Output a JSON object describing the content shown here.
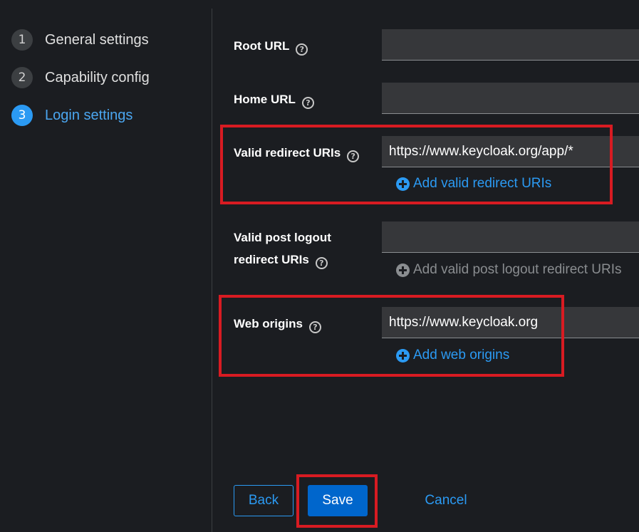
{
  "wizard": {
    "steps": [
      {
        "number": "1",
        "label": "General settings"
      },
      {
        "number": "2",
        "label": "Capability config"
      },
      {
        "number": "3",
        "label": "Login settings",
        "current": true
      }
    ]
  },
  "form": {
    "root_url": {
      "label": "Root URL",
      "value": ""
    },
    "home_url": {
      "label": "Home URL",
      "value": ""
    },
    "valid_redirect_uris": {
      "label": "Valid redirect URIs",
      "value": "https://www.keycloak.org/app/*",
      "add_label": "Add valid redirect URIs"
    },
    "valid_post_logout": {
      "label_line1": "Valid post logout",
      "label_line2": "redirect URIs",
      "value": "",
      "add_label": "Add valid post logout redirect URIs"
    },
    "web_origins": {
      "label": "Web origins",
      "value": "https://www.keycloak.org",
      "add_label": "Add web origins"
    },
    "help_glyph": "?"
  },
  "actions": {
    "back_label": "Back",
    "save_label": "Save",
    "cancel_label": "Cancel"
  },
  "colors": {
    "background": "#1b1d21",
    "accent": "#2b9af3",
    "primary_button": "#0066cc",
    "highlight": "#d81b22",
    "input_bg": "#36373a"
  }
}
